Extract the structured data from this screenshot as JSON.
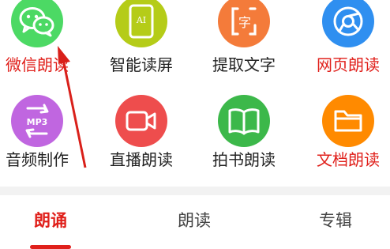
{
  "colors": {
    "wechat": "#4cd964",
    "ai_screen": "#b5cc18",
    "extract": "#f47b3a",
    "web": "#2f8ff0",
    "audio": "#c066e0",
    "live": "#ee4d4d",
    "book": "#3cb84a",
    "doc": "#ff8a00",
    "highlight_text": "#e0201b",
    "normal_text": "#222222",
    "tab_active": "#e0201b",
    "tab_inactive": "#444444",
    "annotation_arrow": "#d9201a"
  },
  "grid": {
    "row1": [
      {
        "label": "微信朗读",
        "icon": "wechat-icon",
        "highlight": true
      },
      {
        "label": "智能读屏",
        "icon": "ai-screen-icon",
        "highlight": false
      },
      {
        "label": "提取文字",
        "icon": "extract-text-icon",
        "highlight": false
      },
      {
        "label": "网页朗读",
        "icon": "browser-icon",
        "highlight": true
      }
    ],
    "row2": [
      {
        "label": "音频制作",
        "icon": "mp3-icon",
        "highlight": false
      },
      {
        "label": "直播朗读",
        "icon": "video-camera-icon",
        "highlight": false
      },
      {
        "label": "拍书朗读",
        "icon": "open-book-icon",
        "highlight": false
      },
      {
        "label": "文档朗读",
        "icon": "folder-icon",
        "highlight": true
      }
    ],
    "ai_icon_text": "AI",
    "extract_icon_text": "字",
    "mp3_icon_text": "MP3"
  },
  "tabs": [
    {
      "label": "朗诵",
      "active": true
    },
    {
      "label": "朗读",
      "active": false
    },
    {
      "label": "专辑",
      "active": false
    }
  ]
}
